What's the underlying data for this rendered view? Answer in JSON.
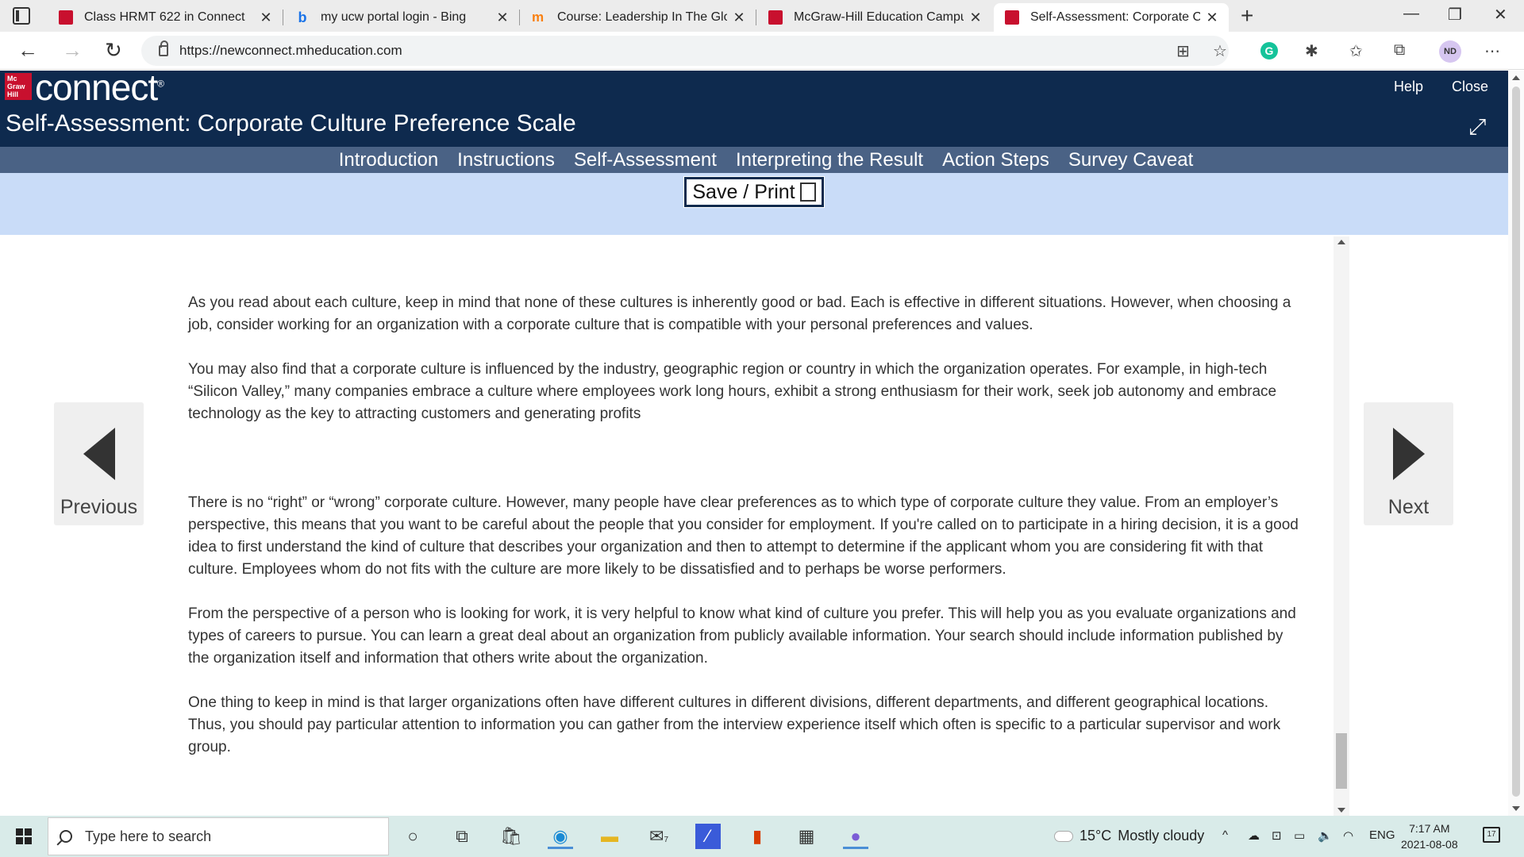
{
  "browser": {
    "tabs": [
      {
        "title": "Class HRMT 622 in Connect",
        "favicon": "mcgraw-hill-icon"
      },
      {
        "title": "my ucw portal login - Bing",
        "favicon": "bing-icon"
      },
      {
        "title": "Course: Leadership In The Global",
        "favicon": "moodle-icon"
      },
      {
        "title": "McGraw-Hill Education Campus",
        "favicon": "mcgraw-hill-icon"
      },
      {
        "title": "Self-Assessment: Corporate Culture",
        "favicon": "mcgraw-hill-icon",
        "active": true
      }
    ],
    "url": "https://newconnect.mheducation.com",
    "profile_initials": "ND",
    "grammarly_letter": "G"
  },
  "connect": {
    "logo_mark": "Mc Graw Hill",
    "logo_word": "connect",
    "help_label": "Help",
    "close_label": "Close",
    "page_title": "Self-Assessment: Corporate Culture Preference Scale"
  },
  "section_nav": {
    "items": [
      "Introduction",
      "Instructions",
      "Self-Assessment",
      "Interpreting the Result",
      "Action Steps",
      "Survey Caveat"
    ]
  },
  "save_print_label": "Save / Print",
  "content": {
    "paragraphs": [
      "As you read about each culture, keep in mind that none of these cultures is inherently good or bad. Each is effective in different situations. However, when choosing a job, consider working for an organization with a corporate culture that is compatible with your personal preferences and values.",
      " You may also find that a corporate culture is influenced by the industry, geographic region or country in which the organization operates. For example, in high-tech “Silicon Valley,” many companies embrace a culture where employees work long hours, exhibit a strong enthusiasm for their work, seek job autonomy and embrace technology as the key to attracting customers and generating profits",
      "There is no “right” or “wrong” corporate culture. However, many people have clear preferences as to which type of corporate culture they value. From an employer’s perspective, this means that you want to be careful about the people that you consider for employment. If you're called on to participate in a hiring decision, it is a good idea to first understand the kind of culture that describes your organization and then to attempt to determine if the applicant whom you are considering fit with that culture. Employees whom do not fits with the culture are more likely to be dissatisfied and to perhaps be worse performers.",
      "From the perspective of a person who is looking for work, it is very helpful to know what kind of culture you prefer. This will help you as you evaluate organizations and types of careers to pursue. You can learn a great deal about an organization from publicly available information. Your search should include information published by the organization itself and information that others write about the organization.",
      "One thing to keep in mind is that larger organizations often have different cultures in different divisions, different departments, and different geographical locations. Thus, you should pay particular attention to information you can gather from the interview experience itself which often is specific to a particular supervisor and work group."
    ]
  },
  "pager": {
    "previous_label": "Previous",
    "next_label": "Next"
  },
  "taskbar": {
    "search_placeholder": "Type here to search",
    "weather_temp": "15°C",
    "weather_desc": "Mostly cloudy",
    "language": "ENG",
    "time": "7:17 AM",
    "date": "2021-08-08",
    "mail_badge": "7",
    "notification_count": "17"
  },
  "colors": {
    "header_bg": "#0e2a4e",
    "nav_bg": "#4a6285",
    "savebar_bg": "#c9dcf8",
    "brand_red": "#c8102e"
  }
}
